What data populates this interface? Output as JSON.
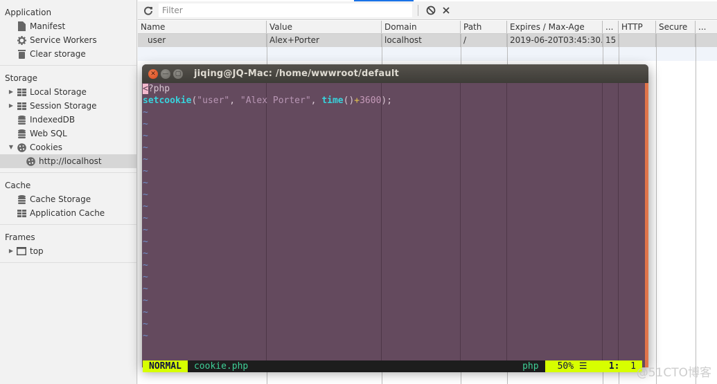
{
  "sidebar": {
    "sections": [
      {
        "title": "Application",
        "items": [
          {
            "label": "Manifest",
            "icon": "document-icon"
          },
          {
            "label": "Service Workers",
            "icon": "gear-icon"
          },
          {
            "label": "Clear storage",
            "icon": "trash-icon"
          }
        ]
      },
      {
        "title": "Storage",
        "items": [
          {
            "label": "Local Storage",
            "icon": "grid-icon",
            "expand": "collapsed"
          },
          {
            "label": "Session Storage",
            "icon": "grid-icon",
            "expand": "collapsed"
          },
          {
            "label": "IndexedDB",
            "icon": "database-icon"
          },
          {
            "label": "Web SQL",
            "icon": "database-icon"
          },
          {
            "label": "Cookies",
            "icon": "cookie-icon",
            "expand": "expanded"
          },
          {
            "label": "http://localhost",
            "icon": "cookie-icon",
            "selected": true
          }
        ]
      },
      {
        "title": "Cache",
        "items": [
          {
            "label": "Cache Storage",
            "icon": "database-icon"
          },
          {
            "label": "Application Cache",
            "icon": "grid-icon"
          }
        ]
      },
      {
        "title": "Frames",
        "items": [
          {
            "label": "top",
            "icon": "frame-icon",
            "expand": "collapsed"
          }
        ]
      }
    ]
  },
  "toolbar": {
    "refresh_icon": "refresh-icon",
    "filter_placeholder": "Filter",
    "filter_value": "",
    "clear_all_icon": "block-icon",
    "delete_icon": "close-icon"
  },
  "cookies_table": {
    "columns": [
      "Name",
      "Value",
      "Domain",
      "Path",
      "Expires / Max-Age",
      "...",
      "HTTP",
      "Secure",
      "..."
    ],
    "rows": [
      {
        "name": "user",
        "value": "Alex+Porter",
        "domain": "localhost",
        "path": "/",
        "expires": "2019-06-20T03:45:30...",
        "size": "15",
        "http": "",
        "secure": "",
        "more": ""
      }
    ]
  },
  "terminal": {
    "title": "jiqing@JQ-Mac: /home/wwwroot/default",
    "code": {
      "line1_cursor": "<",
      "line1_rest": "?php",
      "line2": {
        "fn1": "setcookie",
        "open": "(",
        "arg1": "\"user\"",
        "sep1": ", ",
        "arg2": "\"Alex Porter\"",
        "sep2": ", ",
        "fn2": "time",
        "parens": "()",
        "plus": "+",
        "num": "3600",
        "close": ");"
      }
    },
    "tilde": "~",
    "tilde_count": 20,
    "status": {
      "mode": "NORMAL",
      "filename": "cookie.php",
      "filetype": "php",
      "percent": "50%",
      "percent_icon": "☰",
      "line": "1:",
      "col": "1"
    }
  },
  "watermark": "@51CTO博客"
}
